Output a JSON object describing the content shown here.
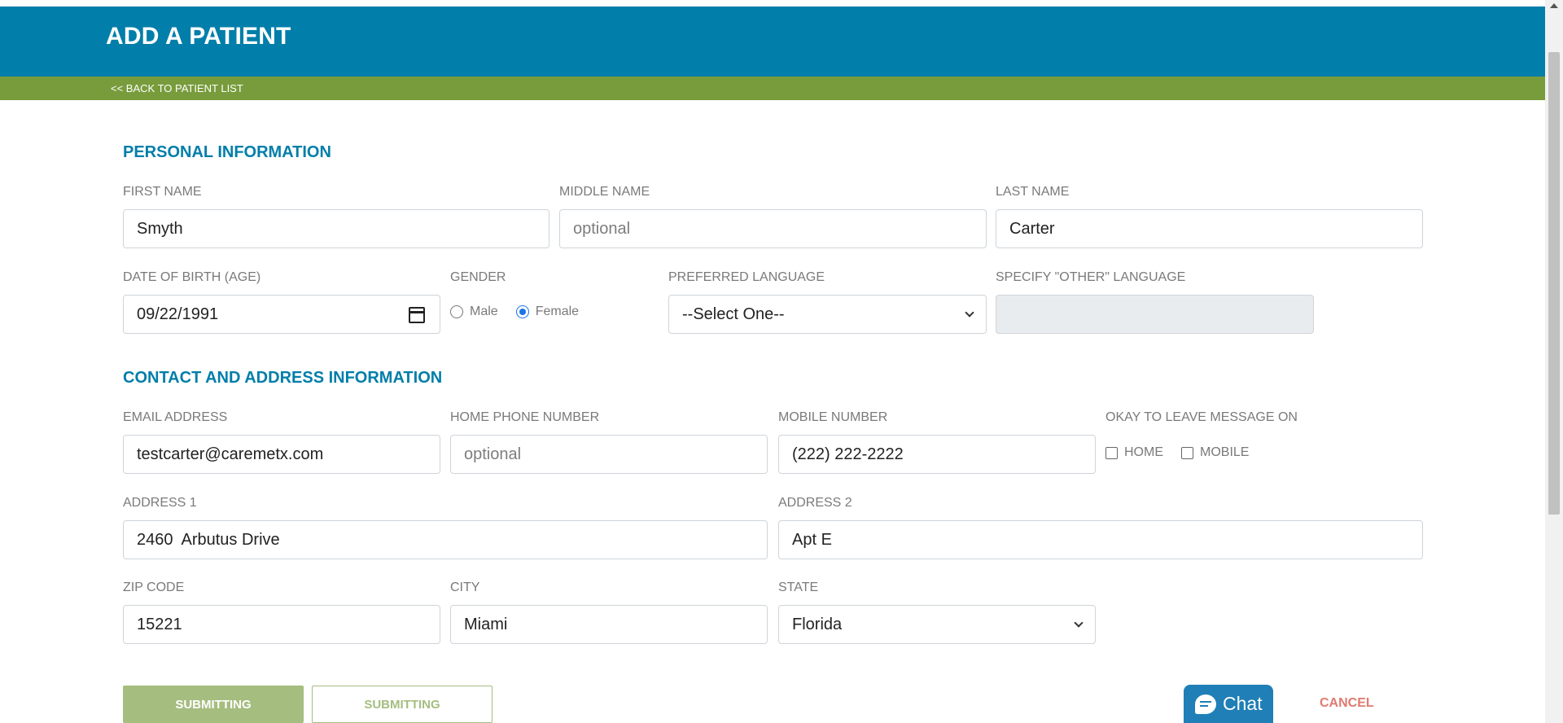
{
  "header": {
    "title": "ADD A PATIENT"
  },
  "subbar": {
    "back_link": "<< BACK TO PATIENT LIST"
  },
  "personal": {
    "title": "PERSONAL INFORMATION",
    "first_name": {
      "label": "FIRST NAME",
      "value": "Smyth"
    },
    "middle_name": {
      "label": "MIDDLE NAME",
      "placeholder": "optional"
    },
    "last_name": {
      "label": "LAST NAME",
      "value": "Carter"
    },
    "dob": {
      "label": "DATE OF BIRTH (AGE)",
      "value": "09/22/1991"
    },
    "gender": {
      "label": "GENDER",
      "options": [
        "Male",
        "Female"
      ],
      "selected": "Female"
    },
    "language": {
      "label": "PREFERRED LANGUAGE",
      "value": "--Select One--"
    },
    "other_language": {
      "label": "SPECIFY \"OTHER\" LANGUAGE",
      "value": ""
    }
  },
  "contact": {
    "title": "CONTACT AND ADDRESS INFORMATION",
    "email": {
      "label": "EMAIL ADDRESS",
      "value": "testcarter@caremetx.com"
    },
    "home_phone": {
      "label": "HOME PHONE NUMBER",
      "placeholder": "optional"
    },
    "mobile": {
      "label": "MOBILE NUMBER",
      "value": "(222) 222-2222"
    },
    "leave_message": {
      "label": "OKAY TO LEAVE MESSAGE ON",
      "options": [
        "HOME",
        "MOBILE"
      ]
    },
    "address1": {
      "label": "ADDRESS 1",
      "value": "2460  Arbutus Drive"
    },
    "address2": {
      "label": "ADDRESS 2",
      "value": "Apt E"
    },
    "zip": {
      "label": "ZIP CODE",
      "value": "15221"
    },
    "city": {
      "label": "CITY",
      "value": "Miami"
    },
    "state": {
      "label": "STATE",
      "value": "Florida"
    }
  },
  "actions": {
    "primary": "SUBMITTING",
    "secondary": "SUBMITTING",
    "cancel": "CANCEL"
  },
  "chat": {
    "label": "Chat"
  }
}
